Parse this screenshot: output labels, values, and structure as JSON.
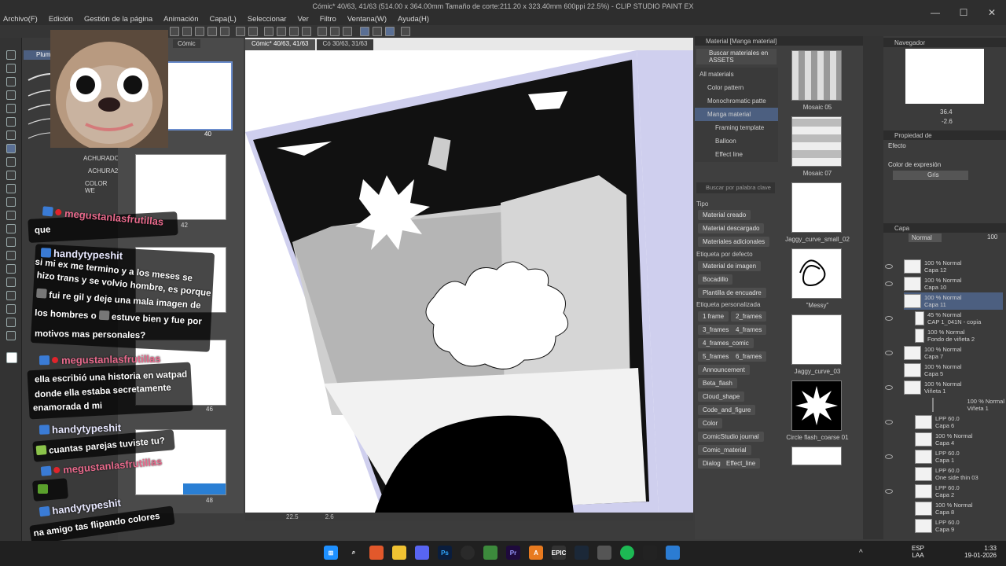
{
  "title": "Cómic* 40/63, 41/63 (514.00 x 364.00mm Tamaño de corte:211.20 x 323.40mm 600ppi 22.5%) - CLIP STUDIO PAINT EX",
  "menu": [
    "Archivo(F)",
    "Edición",
    "Gestión de la página",
    "Animación",
    "Capa(L)",
    "Seleccionar",
    "Ver",
    "Filtro",
    "Ventana(W)",
    "Ayuda(H)"
  ],
  "brush_tab": "Plumill",
  "brush_labels": [
    "ACHURADO",
    "ACHURA2",
    "COLOR WE"
  ],
  "page_tabs": [
    "Cómic"
  ],
  "pages": [
    "40",
    "42",
    "46",
    "48"
  ],
  "canvas_tabs": [
    "Cómic* 40/63, 41/63",
    "Có 30/63, 31/63"
  ],
  "canvas_status": {
    "zoom": "22.5",
    "rotation": "2.6"
  },
  "material": {
    "header": "Material [Manga material]",
    "search_assets": "Buscar materiales en ASSETS",
    "tree": [
      "All materials",
      "Color pattern",
      "Monochromatic patte",
      "Manga material",
      "Framing template",
      "Balloon",
      "Effect line"
    ],
    "search_placeholder": "Buscar por palabra clave",
    "tipo_label": "Tipo",
    "tipo": [
      "Material creado",
      "Material descargado",
      "Materiales adicionales"
    ],
    "default_tag_label": "Etiqueta por defecto",
    "default_tags": [
      "Material de imagen",
      "Bocadillo",
      "Plantilla de encuadre"
    ],
    "custom_tag_label": "Etiqueta personalizada",
    "custom_tags": [
      "1 frame",
      "2_frames",
      "3_frames",
      "4_frames",
      "4_frames_comic",
      "5_frames",
      "6_frames",
      "Announcement",
      "Beta_flash",
      "Cloud_shape",
      "Code_and_figure",
      "Color",
      "ComicStudio journal",
      "Comic_material",
      "Dialog",
      "Effect_line"
    ],
    "items": [
      "Mosaic 05",
      "Mosaic 07",
      "Jaggy_curve_small_02",
      "\"Messy\"",
      "Jaggy_curve_03",
      "Circle flash_coarse 01"
    ]
  },
  "navigator": {
    "title": "Navegador",
    "zoom": "36.4",
    "rotation": "-2.6"
  },
  "properties": {
    "title": "Propiedad de",
    "effect": "Efecto",
    "color_label": "Color de expresión",
    "color_value": "Gris"
  },
  "layers_panel": {
    "title": "Capa",
    "blend": "Normal",
    "opacity": "100"
  },
  "layers": [
    {
      "mode": "100 % Normal",
      "name": "Capa 12"
    },
    {
      "mode": "100 % Normal",
      "name": "Capa 10"
    },
    {
      "mode": "100 % Normal",
      "name": "Capa 11"
    },
    {
      "mode": "45 % Normal",
      "name": "CAP 1_041N - copia"
    },
    {
      "mode": "100 % Normal",
      "name": "Fondo de viñeta 2"
    },
    {
      "mode": "100 % Normal",
      "name": "Capa 7"
    },
    {
      "mode": "100 % Normal",
      "name": "Capa 5"
    },
    {
      "mode": "100 % Normal",
      "name": "Viñeta 1"
    },
    {
      "mode": "100 % Normal",
      "name": "Viñeta 1"
    },
    {
      "mode": "LPP 60.0",
      "name": "Capa 6"
    },
    {
      "mode": "100 % Normal",
      "name": "Capa 4"
    },
    {
      "mode": "LPP 60.0",
      "name": "Capa 1"
    },
    {
      "mode": "LPP 60.0",
      "name": "One side thin 03"
    },
    {
      "mode": "LPP 60.0",
      "name": "Capa 2"
    },
    {
      "mode": "100 % Normal",
      "name": "Capa 8"
    },
    {
      "mode": "LPP 60.0",
      "name": "Capa 9"
    }
  ],
  "chat": [
    {
      "user": "",
      "text": "que"
    },
    {
      "user": "megustanlasfrutillas",
      "text": ""
    },
    {
      "user": "handytypeshit",
      "text": "si mi ex me termino y a los meses se"
    },
    {
      "user": "",
      "text": "hizo trans y se volvio hombre, es porque"
    },
    {
      "user": "",
      "text": "fui re gil y deje una mala imagen de"
    },
    {
      "user": "",
      "text": "los hombres o"
    },
    {
      "user": "",
      "text": "estuve bien y fue por"
    },
    {
      "user": "",
      "text": "motivos mas personales?"
    },
    {
      "user": "megustanlasfrutillas",
      "text": ""
    },
    {
      "user": "",
      "text": "ella escribió una historia en watpad"
    },
    {
      "user": "",
      "text": "donde ella estaba secretamente"
    },
    {
      "user": "",
      "text": "enamorada d mi"
    },
    {
      "user": "handytypeshit",
      "text": ""
    },
    {
      "user": "",
      "text": "cuantas parejas tuviste tu?"
    },
    {
      "user": "megustanlasfrutillas",
      "text": ""
    },
    {
      "user": "handytypeshit",
      "text": ""
    },
    {
      "user": "",
      "text": "na amigo tas flipando colores"
    }
  ],
  "taskbar": {
    "lang1": "ESP",
    "lang2": "LAA",
    "time": "1:33",
    "date": "19-01-2026"
  }
}
